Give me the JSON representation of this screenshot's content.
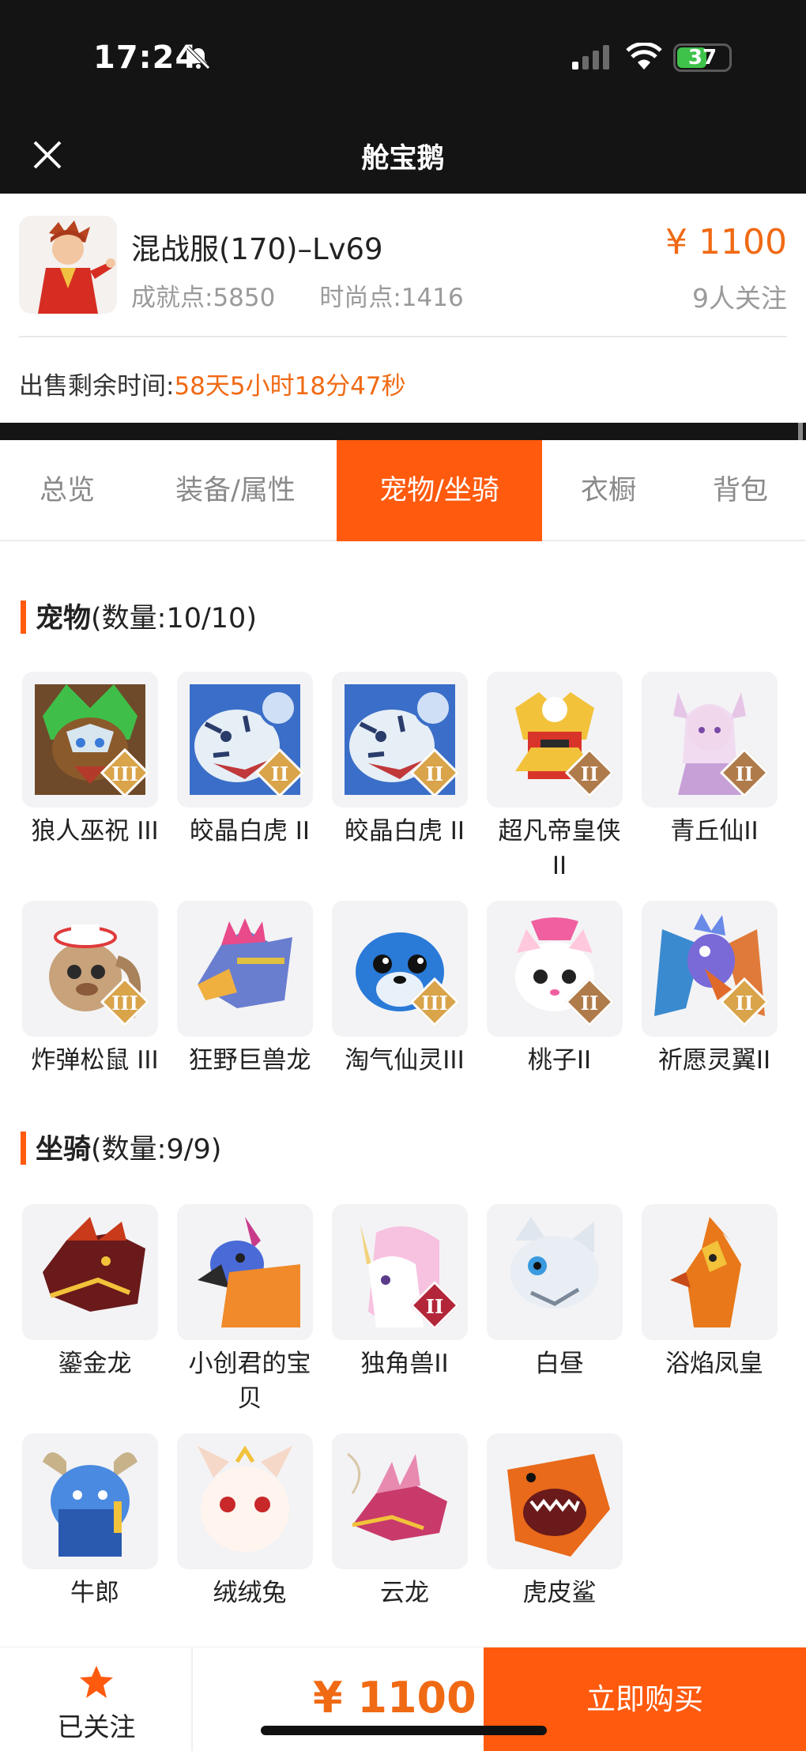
{
  "status": {
    "time": "17:24",
    "battery": "37"
  },
  "nav": {
    "title": "舱宝鹅"
  },
  "product": {
    "server_name": "混战服(170)–Lv69",
    "achievement": "成就点:5850",
    "fashion": "时尚点:1416",
    "price": "¥ 1100",
    "followers": "9人关注",
    "remain_label": "出售剩余时间:",
    "remain_value": "58天5小时18分47秒"
  },
  "tabs": [
    "总览",
    "装备/属性",
    "宠物/坐骑",
    "衣橱",
    "背包"
  ],
  "pets": {
    "title": "宠物",
    "count": "(数量:10/10)",
    "items": [
      {
        "name": "狼人巫祝 III",
        "badge": "III",
        "badge_color": "#d9a44a",
        "icon": "werewolf-shaman-icon"
      },
      {
        "name": "皎晶白虎 II",
        "badge": "II",
        "badge_color": "#d9a44a",
        "icon": "white-tiger-icon"
      },
      {
        "name": "皎晶白虎 II",
        "badge": "II",
        "badge_color": "#d9a44a",
        "icon": "white-tiger-icon"
      },
      {
        "name": "超凡帝皇侠 II",
        "badge": "II",
        "badge_color": "#b07b4a",
        "icon": "golden-warrior-icon"
      },
      {
        "name": "青丘仙II",
        "badge": "II",
        "badge_color": "#b07b4a",
        "icon": "fox-fairy-icon"
      },
      {
        "name": "炸弹松鼠 III",
        "badge": "III",
        "badge_color": "#d9a44a",
        "icon": "bomb-squirrel-icon"
      },
      {
        "name": "狂野巨兽龙",
        "badge": "",
        "badge_color": "",
        "icon": "wild-dragon-icon"
      },
      {
        "name": "淘气仙灵III",
        "badge": "III",
        "badge_color": "#d9a44a",
        "icon": "naughty-sprite-icon"
      },
      {
        "name": "桃子II",
        "badge": "II",
        "badge_color": "#b07b4a",
        "icon": "peach-cat-icon"
      },
      {
        "name": "祈愿灵翼II",
        "badge": "II",
        "badge_color": "#d9a44a",
        "icon": "wish-eagle-icon"
      }
    ]
  },
  "mounts": {
    "title": "坐骑",
    "count": "(数量:9/9)",
    "items": [
      {
        "name": "鎏金龙",
        "badge": "",
        "badge_color": "",
        "icon": "gilded-dragon-icon"
      },
      {
        "name": "小创君的宝贝",
        "badge": "",
        "badge_color": "",
        "icon": "phoenix-bird-icon"
      },
      {
        "name": "独角兽II",
        "badge": "II",
        "badge_color": "#b3263a",
        "icon": "unicorn-icon"
      },
      {
        "name": "白昼",
        "badge": "",
        "badge_color": "",
        "icon": "white-cat-icon"
      },
      {
        "name": "浴焰凤皇",
        "badge": "",
        "badge_color": "",
        "icon": "flame-phoenix-icon"
      },
      {
        "name": "牛郎",
        "badge": "",
        "badge_color": "",
        "icon": "blue-ox-icon"
      },
      {
        "name": "绒绒兔",
        "badge": "",
        "badge_color": "",
        "icon": "fluffy-rabbit-icon"
      },
      {
        "name": "云龙",
        "badge": "",
        "badge_color": "",
        "icon": "cloud-dragon-icon"
      },
      {
        "name": "虎皮鲨",
        "badge": "",
        "badge_color": "",
        "icon": "tiger-shark-icon"
      }
    ]
  },
  "bottom": {
    "follow_label": "已关注",
    "price": "¥ 1100",
    "buy_label": "立即购买"
  },
  "colors": {
    "accent": "#ff5a0e",
    "price": "#f06a14"
  }
}
